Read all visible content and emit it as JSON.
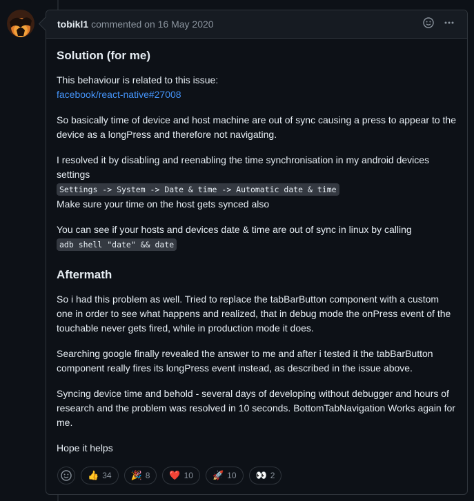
{
  "comment": {
    "author": "tobikl1",
    "meta": "commented on 16 May 2020"
  },
  "content": {
    "h_solution": "Solution (for me)",
    "p1_text": "This behaviour is related to this issue:",
    "p1_link": "facebook/react-native#27008",
    "p2": "So basically time of device and host machine are out of sync causing a press to appear to the device as a longPress and therefore not navigating.",
    "p3_text": "I resolved it by disabling and reenabling the time synchronisation in my android devices settings",
    "p3_code": "Settings -> System -> Date & time -> Automatic date & time",
    "p3_after": "Make sure your time on the host gets synced also",
    "p4_text": "You can see if your hosts and devices date & time are out of sync in linux by calling",
    "p4_code": "adb shell \"date\" && date",
    "h_aftermath": "Aftermath",
    "p5": "So i had this problem as well. Tried to replace the tabBarButton component with a custom one in order to see what happens and realized, that in debug mode the onPress event of the touchable never gets fired, while in production mode it does.",
    "p6": "Searching google finally revealed the answer to me and after i tested it the tabBarButton component really fires its longPress event instead, as described in the issue above.",
    "p7": "Syncing device time and behold - several days of developing without debugger and hours of research and the problem was resolved in 10 seconds. BottomTabNavigation Works again for me.",
    "p8": "Hope it helps"
  },
  "reactions": [
    {
      "icon": "thumbs-up",
      "emoji": "👍",
      "count": "34"
    },
    {
      "icon": "party-popper",
      "emoji": "🎉",
      "count": "8"
    },
    {
      "icon": "heart",
      "emoji": "❤️",
      "count": "10"
    },
    {
      "icon": "rocket",
      "emoji": "🚀",
      "count": "10"
    },
    {
      "icon": "eyes",
      "emoji": "👀",
      "count": "2"
    }
  ],
  "colors": {
    "link": "#4493f8",
    "background": "#0d1117",
    "header": "#161b22",
    "border": "#30363d"
  }
}
